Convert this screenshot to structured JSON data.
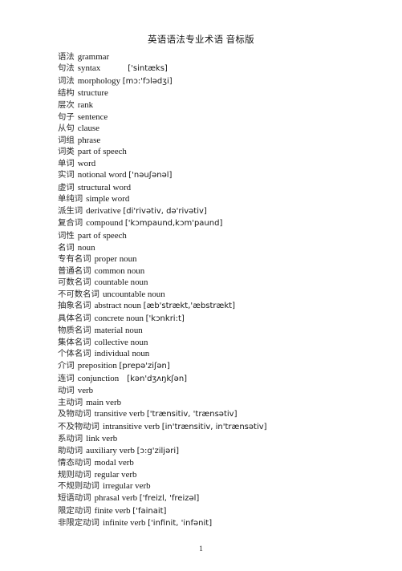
{
  "document": {
    "title": "英语语法专业术语  音标版",
    "page_number": "1"
  },
  "terms": [
    {
      "zh": "语法",
      "en": "grammar",
      "ipa": "",
      "spacer": "none"
    },
    {
      "zh": "句法",
      "en": "syntax",
      "ipa": "['sintæks]",
      "spacer": "wide"
    },
    {
      "zh": "词法",
      "en": "morphology",
      "ipa": "[mɔ:'fɔlədʒi]",
      "spacer": "none"
    },
    {
      "zh": "结构",
      "en": "structure",
      "ipa": "",
      "spacer": "none"
    },
    {
      "zh": "层次",
      "en": "rank",
      "ipa": "",
      "spacer": "none"
    },
    {
      "zh": "句子",
      "en": "sentence",
      "ipa": "",
      "spacer": "none"
    },
    {
      "zh": "从句",
      "en": "clause",
      "ipa": "",
      "spacer": "none"
    },
    {
      "zh": "词组",
      "en": "phrase",
      "ipa": "",
      "spacer": "none"
    },
    {
      "zh": "词类",
      "en": "part of speech",
      "ipa": "",
      "spacer": "none"
    },
    {
      "zh": "单词",
      "en": "word",
      "ipa": "",
      "spacer": "none"
    },
    {
      "zh": "实词",
      "en": "notional word",
      "ipa": "['nəuʃənəl]",
      "spacer": "none"
    },
    {
      "zh": "虚词",
      "en": "structural word",
      "ipa": "",
      "spacer": "none"
    },
    {
      "zh": "单纯词",
      "en": "simple word",
      "ipa": "",
      "spacer": "none"
    },
    {
      "zh": "派生词",
      "en": "derivative",
      "ipa": "[di'rivətiv, də'rivətiv]",
      "spacer": "none"
    },
    {
      "zh": "复合词",
      "en": "compound",
      "ipa": "['kɔmpaund,kɔm'paund]",
      "spacer": "none"
    },
    {
      "zh": "词性",
      "en": "part of speech",
      "ipa": "",
      "spacer": "none"
    },
    {
      "zh": "名词",
      "en": "noun",
      "ipa": "",
      "spacer": "none"
    },
    {
      "zh": "专有名词",
      "en": "proper noun",
      "ipa": "",
      "spacer": "none"
    },
    {
      "zh": "普通名词",
      "en": "common noun",
      "ipa": "",
      "spacer": "none"
    },
    {
      "zh": "可数名词",
      "en": "countable noun",
      "ipa": "",
      "spacer": "none"
    },
    {
      "zh": "不可数名词",
      "en": "uncountable noun",
      "ipa": "",
      "spacer": "none"
    },
    {
      "zh": "抽象名词",
      "en": "abstract noun",
      "ipa": "[æb'strækt,'æbstrækt]",
      "spacer": "none"
    },
    {
      "zh": "具体名词",
      "en": "concrete noun",
      "ipa": "['kɔnkri:t]",
      "spacer": "none"
    },
    {
      "zh": "物质名词",
      "en": "material noun",
      "ipa": "",
      "spacer": "none"
    },
    {
      "zh": "集体名词",
      "en": "collective noun",
      "ipa": "",
      "spacer": "none"
    },
    {
      "zh": "个体名词",
      "en": "individual noun",
      "ipa": "",
      "spacer": "none"
    },
    {
      "zh": "介词",
      "en": "preposition",
      "ipa": "[prepə'ziʃən]",
      "spacer": "none"
    },
    {
      "zh": "连词",
      "en": "conjunction",
      "ipa": "[kən'dʒʌŋkʃən]",
      "spacer": "mid"
    },
    {
      "zh": "动词",
      "en": "verb",
      "ipa": "",
      "spacer": "none"
    },
    {
      "zh": "主动词",
      "en": "main verb",
      "ipa": "",
      "spacer": "none"
    },
    {
      "zh": "及物动词",
      "en": "transitive verb",
      "ipa": "['trænsitiv, 'trænsətiv]",
      "spacer": "none"
    },
    {
      "zh": "不及物动词",
      "en": "intransitive verb",
      "ipa": "[in'trænsitiv, in'trænsətiv]",
      "spacer": "none"
    },
    {
      "zh": "系动词",
      "en": "link verb",
      "ipa": "",
      "spacer": "none"
    },
    {
      "zh": "助动词",
      "en": "auxiliary verb",
      "ipa": "[ɔ:g'ziljəri]",
      "spacer": "none"
    },
    {
      "zh": "情态动词",
      "en": "modal verb",
      "ipa": "",
      "spacer": "none"
    },
    {
      "zh": "规则动词",
      "en": "regular verb",
      "ipa": "",
      "spacer": "none"
    },
    {
      "zh": "不规则动词",
      "en": "irregular verb",
      "ipa": "",
      "spacer": "none"
    },
    {
      "zh": "短语动词",
      "en": "phrasal verb",
      "ipa": "['freizl, 'freizəl]",
      "spacer": "none"
    },
    {
      "zh": "限定动词",
      "en": "finite verb",
      "ipa": "['fainait]",
      "spacer": "none"
    },
    {
      "zh": "非限定动词",
      "en": "infinite verb",
      "ipa": "['infinit, 'infənit]",
      "spacer": "none"
    }
  ]
}
